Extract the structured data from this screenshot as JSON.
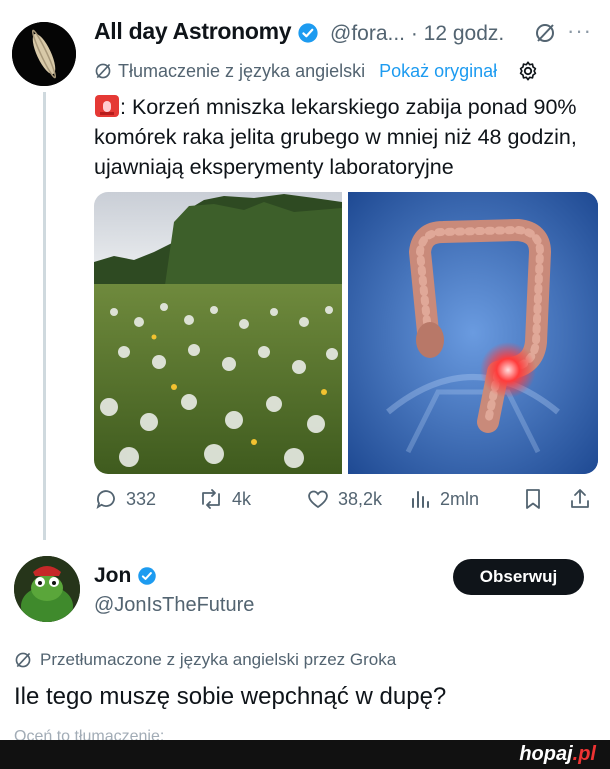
{
  "tweet": {
    "author_name": "All day Astronomy",
    "handle_time": "@fora... · 12 godz.",
    "translation_note": "Tłumaczenie z języka angielski",
    "show_original": "Pokaż oryginał",
    "text": ": Korzeń mniszka lekarskiego zabija ponad 90% komórek raka jelita grubego w mniej niż 48 godzin, ujawniają eksperymenty laboratoryjne",
    "image_left_alt": "",
    "image_right_alt": "",
    "stats": {
      "replies": "332",
      "reposts": "4k",
      "likes": "38,2k",
      "views": "2mln"
    }
  },
  "reply": {
    "author_name": "Jon",
    "handle": "@JonIsTheFuture",
    "follow_label": "Obserwuj",
    "grok_note": "Przetłumaczone z języka angielski przez Groka",
    "text": "Ile tego muszę sobie wepchnąć w dupę?",
    "cut_text": "Oceń to tłumaczenie:"
  },
  "watermark": {
    "brand": "hopaj",
    "brand_tld": ".pl"
  },
  "colors": {
    "verified": "#1d9bf0",
    "link": "#1d9bf0",
    "text": "#0f1419",
    "secondary": "#536471"
  }
}
